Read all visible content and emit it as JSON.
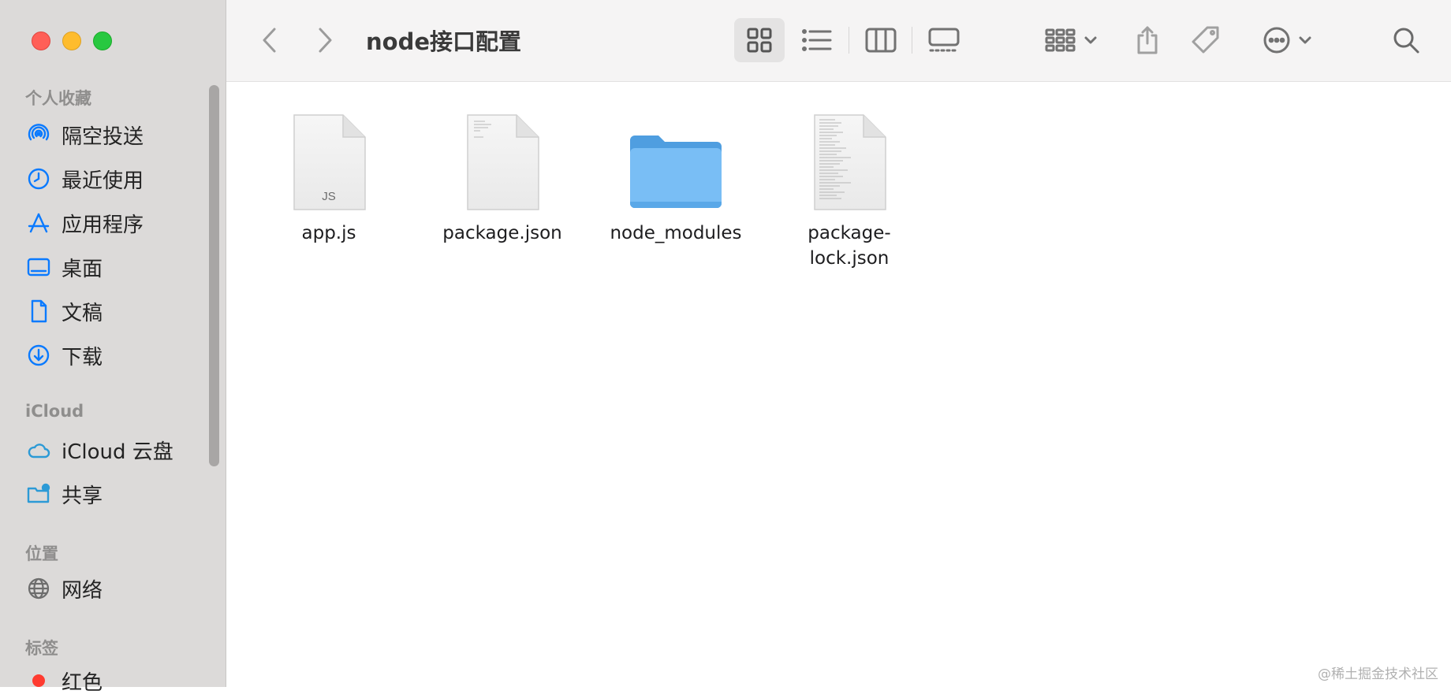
{
  "window": {
    "title": "node接口配置"
  },
  "sidebar": {
    "sections": [
      {
        "label": "个人收藏"
      },
      {
        "label": "iCloud"
      },
      {
        "label": "位置"
      },
      {
        "label": "标签"
      }
    ],
    "favorites": [
      {
        "label": "隔空投送",
        "icon": "airdrop-icon"
      },
      {
        "label": "最近使用",
        "icon": "clock-icon"
      },
      {
        "label": "应用程序",
        "icon": "applications-icon"
      },
      {
        "label": "桌面",
        "icon": "desktop-icon"
      },
      {
        "label": "文稿",
        "icon": "document-icon"
      },
      {
        "label": "下载",
        "icon": "download-icon"
      }
    ],
    "icloud": [
      {
        "label": "iCloud 云盘",
        "icon": "cloud-icon"
      },
      {
        "label": "共享",
        "icon": "shared-folder-icon"
      }
    ],
    "locations": [
      {
        "label": "网络",
        "icon": "globe-icon"
      }
    ],
    "tags": [
      {
        "label": "红色",
        "color": "#ff3b30"
      }
    ]
  },
  "files": [
    {
      "name": "app.js",
      "kind": "js",
      "badge": "JS"
    },
    {
      "name": "package.json",
      "kind": "doc"
    },
    {
      "name": "node_modules",
      "kind": "folder"
    },
    {
      "name_line1": "package-",
      "name_line2": "lock.json",
      "kind": "doc-text"
    }
  ],
  "watermark": "@稀土掘金技术社区",
  "colors": {
    "accent": "#0a7aff",
    "sidebar_bg": "#dcdad9",
    "folder": "#79bef5"
  }
}
